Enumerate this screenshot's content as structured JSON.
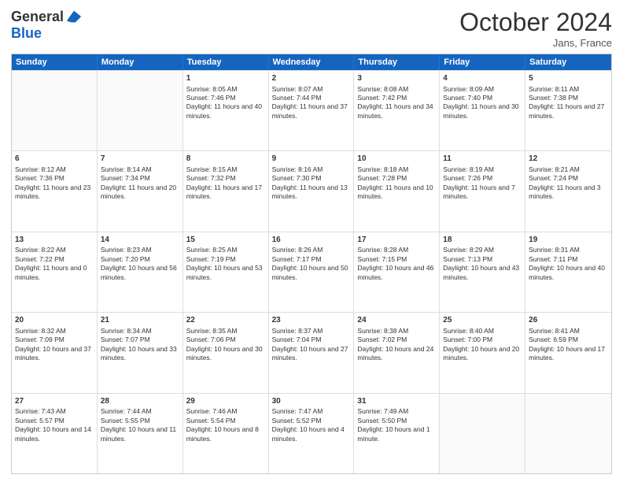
{
  "header": {
    "logo_line1": "General",
    "logo_line2": "Blue",
    "month_year": "October 2024",
    "location": "Jans, France"
  },
  "days_of_week": [
    "Sunday",
    "Monday",
    "Tuesday",
    "Wednesday",
    "Thursday",
    "Friday",
    "Saturday"
  ],
  "weeks": [
    [
      {
        "day": "",
        "sunrise": "",
        "sunset": "",
        "daylight": ""
      },
      {
        "day": "",
        "sunrise": "",
        "sunset": "",
        "daylight": ""
      },
      {
        "day": "1",
        "sunrise": "Sunrise: 8:05 AM",
        "sunset": "Sunset: 7:46 PM",
        "daylight": "Daylight: 11 hours and 40 minutes."
      },
      {
        "day": "2",
        "sunrise": "Sunrise: 8:07 AM",
        "sunset": "Sunset: 7:44 PM",
        "daylight": "Daylight: 11 hours and 37 minutes."
      },
      {
        "day": "3",
        "sunrise": "Sunrise: 8:08 AM",
        "sunset": "Sunset: 7:42 PM",
        "daylight": "Daylight: 11 hours and 34 minutes."
      },
      {
        "day": "4",
        "sunrise": "Sunrise: 8:09 AM",
        "sunset": "Sunset: 7:40 PM",
        "daylight": "Daylight: 11 hours and 30 minutes."
      },
      {
        "day": "5",
        "sunrise": "Sunrise: 8:11 AM",
        "sunset": "Sunset: 7:38 PM",
        "daylight": "Daylight: 11 hours and 27 minutes."
      }
    ],
    [
      {
        "day": "6",
        "sunrise": "Sunrise: 8:12 AM",
        "sunset": "Sunset: 7:36 PM",
        "daylight": "Daylight: 11 hours and 23 minutes."
      },
      {
        "day": "7",
        "sunrise": "Sunrise: 8:14 AM",
        "sunset": "Sunset: 7:34 PM",
        "daylight": "Daylight: 11 hours and 20 minutes."
      },
      {
        "day": "8",
        "sunrise": "Sunrise: 8:15 AM",
        "sunset": "Sunset: 7:32 PM",
        "daylight": "Daylight: 11 hours and 17 minutes."
      },
      {
        "day": "9",
        "sunrise": "Sunrise: 8:16 AM",
        "sunset": "Sunset: 7:30 PM",
        "daylight": "Daylight: 11 hours and 13 minutes."
      },
      {
        "day": "10",
        "sunrise": "Sunrise: 8:18 AM",
        "sunset": "Sunset: 7:28 PM",
        "daylight": "Daylight: 11 hours and 10 minutes."
      },
      {
        "day": "11",
        "sunrise": "Sunrise: 8:19 AM",
        "sunset": "Sunset: 7:26 PM",
        "daylight": "Daylight: 11 hours and 7 minutes."
      },
      {
        "day": "12",
        "sunrise": "Sunrise: 8:21 AM",
        "sunset": "Sunset: 7:24 PM",
        "daylight": "Daylight: 11 hours and 3 minutes."
      }
    ],
    [
      {
        "day": "13",
        "sunrise": "Sunrise: 8:22 AM",
        "sunset": "Sunset: 7:22 PM",
        "daylight": "Daylight: 11 hours and 0 minutes."
      },
      {
        "day": "14",
        "sunrise": "Sunrise: 8:23 AM",
        "sunset": "Sunset: 7:20 PM",
        "daylight": "Daylight: 10 hours and 56 minutes."
      },
      {
        "day": "15",
        "sunrise": "Sunrise: 8:25 AM",
        "sunset": "Sunset: 7:19 PM",
        "daylight": "Daylight: 10 hours and 53 minutes."
      },
      {
        "day": "16",
        "sunrise": "Sunrise: 8:26 AM",
        "sunset": "Sunset: 7:17 PM",
        "daylight": "Daylight: 10 hours and 50 minutes."
      },
      {
        "day": "17",
        "sunrise": "Sunrise: 8:28 AM",
        "sunset": "Sunset: 7:15 PM",
        "daylight": "Daylight: 10 hours and 46 minutes."
      },
      {
        "day": "18",
        "sunrise": "Sunrise: 8:29 AM",
        "sunset": "Sunset: 7:13 PM",
        "daylight": "Daylight: 10 hours and 43 minutes."
      },
      {
        "day": "19",
        "sunrise": "Sunrise: 8:31 AM",
        "sunset": "Sunset: 7:11 PM",
        "daylight": "Daylight: 10 hours and 40 minutes."
      }
    ],
    [
      {
        "day": "20",
        "sunrise": "Sunrise: 8:32 AM",
        "sunset": "Sunset: 7:09 PM",
        "daylight": "Daylight: 10 hours and 37 minutes."
      },
      {
        "day": "21",
        "sunrise": "Sunrise: 8:34 AM",
        "sunset": "Sunset: 7:07 PM",
        "daylight": "Daylight: 10 hours and 33 minutes."
      },
      {
        "day": "22",
        "sunrise": "Sunrise: 8:35 AM",
        "sunset": "Sunset: 7:06 PM",
        "daylight": "Daylight: 10 hours and 30 minutes."
      },
      {
        "day": "23",
        "sunrise": "Sunrise: 8:37 AM",
        "sunset": "Sunset: 7:04 PM",
        "daylight": "Daylight: 10 hours and 27 minutes."
      },
      {
        "day": "24",
        "sunrise": "Sunrise: 8:38 AM",
        "sunset": "Sunset: 7:02 PM",
        "daylight": "Daylight: 10 hours and 24 minutes."
      },
      {
        "day": "25",
        "sunrise": "Sunrise: 8:40 AM",
        "sunset": "Sunset: 7:00 PM",
        "daylight": "Daylight: 10 hours and 20 minutes."
      },
      {
        "day": "26",
        "sunrise": "Sunrise: 8:41 AM",
        "sunset": "Sunset: 6:59 PM",
        "daylight": "Daylight: 10 hours and 17 minutes."
      }
    ],
    [
      {
        "day": "27",
        "sunrise": "Sunrise: 7:43 AM",
        "sunset": "Sunset: 5:57 PM",
        "daylight": "Daylight: 10 hours and 14 minutes."
      },
      {
        "day": "28",
        "sunrise": "Sunrise: 7:44 AM",
        "sunset": "Sunset: 5:55 PM",
        "daylight": "Daylight: 10 hours and 11 minutes."
      },
      {
        "day": "29",
        "sunrise": "Sunrise: 7:46 AM",
        "sunset": "Sunset: 5:54 PM",
        "daylight": "Daylight: 10 hours and 8 minutes."
      },
      {
        "day": "30",
        "sunrise": "Sunrise: 7:47 AM",
        "sunset": "Sunset: 5:52 PM",
        "daylight": "Daylight: 10 hours and 4 minutes."
      },
      {
        "day": "31",
        "sunrise": "Sunrise: 7:49 AM",
        "sunset": "Sunset: 5:50 PM",
        "daylight": "Daylight: 10 hours and 1 minute."
      },
      {
        "day": "",
        "sunrise": "",
        "sunset": "",
        "daylight": ""
      },
      {
        "day": "",
        "sunrise": "",
        "sunset": "",
        "daylight": ""
      }
    ]
  ]
}
